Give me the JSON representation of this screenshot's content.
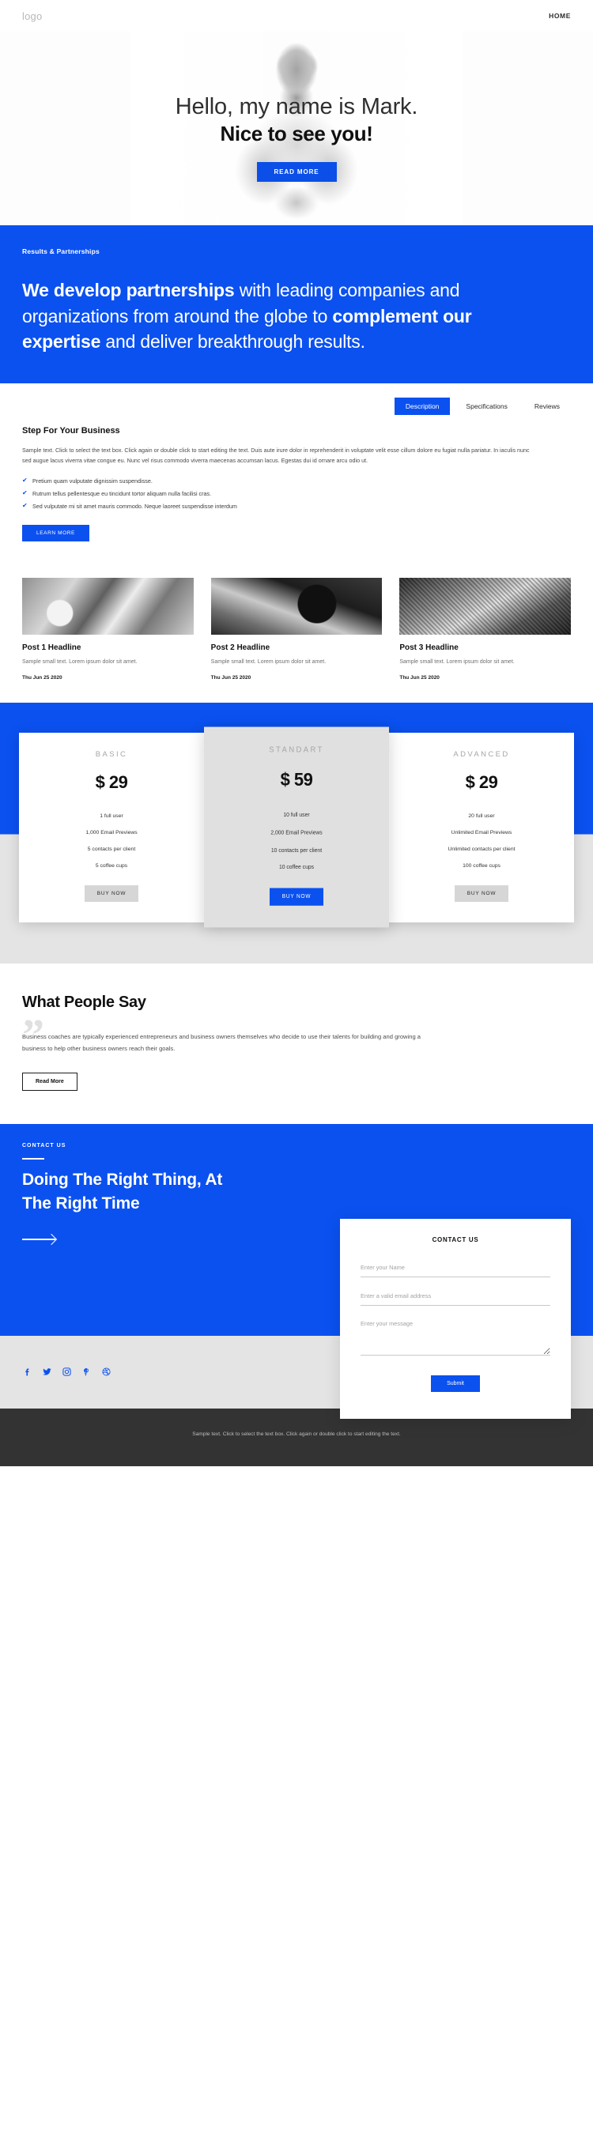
{
  "header": {
    "logo": "logo",
    "nav": [
      {
        "label": "HOME"
      }
    ]
  },
  "hero": {
    "title_line1": "Hello, my name is Mark.",
    "title_line2": "Nice to see you!",
    "cta": "READ MORE"
  },
  "partners": {
    "eyebrow": "Results & Partnerships",
    "part1": "We develop partnerships",
    "part2": " with leading companies and organizations from around the globe to ",
    "part3": "complement our expertise",
    "part4": " and deliver breakthrough results."
  },
  "tabs": {
    "items": [
      {
        "label": "Description",
        "active": true
      },
      {
        "label": "Specifications",
        "active": false
      },
      {
        "label": "Reviews",
        "active": false
      }
    ]
  },
  "description": {
    "heading": "Step For Your Business",
    "body": "Sample text. Click to select the text box. Click again or double click to start editing the text. Duis aute irure dolor in reprehenderit in voluptate velit esse cillum dolore eu fugiat nulla pariatur. In iaculis nunc sed augue lacus viverra vitae congue eu. Nunc vel risus commodo viverra maecenas accumsan lacus. Egestas dui id ornare arcu odio ut.",
    "features": [
      "Pretium quam vulputate dignissim suspendisse.",
      "Rutrum tellus pellentesque eu tincidunt tortor aliquam nulla facilisi cras.",
      "Sed vulputate mi sit amet mauris commodo. Neque laoreet suspendisse interdum"
    ],
    "cta": "LEARN MORE"
  },
  "posts": [
    {
      "title": "Post 1 Headline",
      "text": "Sample small text. Lorem ipsum dolor sit amet.",
      "date": "Thu Jun 25 2020"
    },
    {
      "title": "Post 2 Headline",
      "text": "Sample small text. Lorem ipsum dolor sit amet.",
      "date": "Thu Jun 25 2020"
    },
    {
      "title": "Post 3 Headline",
      "text": "Sample small text. Lorem ipsum dolor sit amet.",
      "date": "Thu Jun 25 2020"
    }
  ],
  "pricing": {
    "plans": [
      {
        "name": "BASIC",
        "price": "$ 29",
        "f1": "1 full user",
        "f2": "1,000 Email Previews",
        "f3": "5 contacts per client",
        "f4": "5 coffee cups",
        "cta": "BUY NOW"
      },
      {
        "name": "STANDART",
        "price": "$ 59",
        "f1": "10 full user",
        "f2": "2,000 Email Previews",
        "f3": "10 contacts per client",
        "f4": "10 coffee cups",
        "cta": "BUY NOW"
      },
      {
        "name": "ADVANCED",
        "price": "$ 29",
        "f1": "20 full user",
        "f2": "Unlimited Email Previews",
        "f3": "Unlimited contacts per client",
        "f4": "100 coffee cups",
        "cta": "BUY NOW"
      }
    ]
  },
  "testimonial": {
    "heading": "What People Say",
    "quote_mark": "”",
    "body": "Business coaches are typically experienced entrepreneurs and business owners themselves who decide to use their talents for building and growing a business to help other business owners reach their goals.",
    "cta": "Read More"
  },
  "contact": {
    "eyebrow": "CONTACT US",
    "heading": "Doing The Right Thing, At The Right Time",
    "form_title": "CONTACT US",
    "name_placeholder": "Enter your Name",
    "email_placeholder": "Enter a valid email address",
    "message_placeholder": "Enter your message",
    "submit": "Submit"
  },
  "social": [
    {
      "name": "facebook-icon"
    },
    {
      "name": "twitter-icon"
    },
    {
      "name": "instagram-icon"
    },
    {
      "name": "pinterest-icon"
    },
    {
      "name": "dribbble-icon"
    }
  ],
  "footer": {
    "text": "Sample text. Click to select the text box. Click again or double click to start editing the text."
  },
  "colors": {
    "brand_blue": "#0b51f0",
    "dark_footer": "#333333",
    "light_gray": "#e4e4e4"
  }
}
